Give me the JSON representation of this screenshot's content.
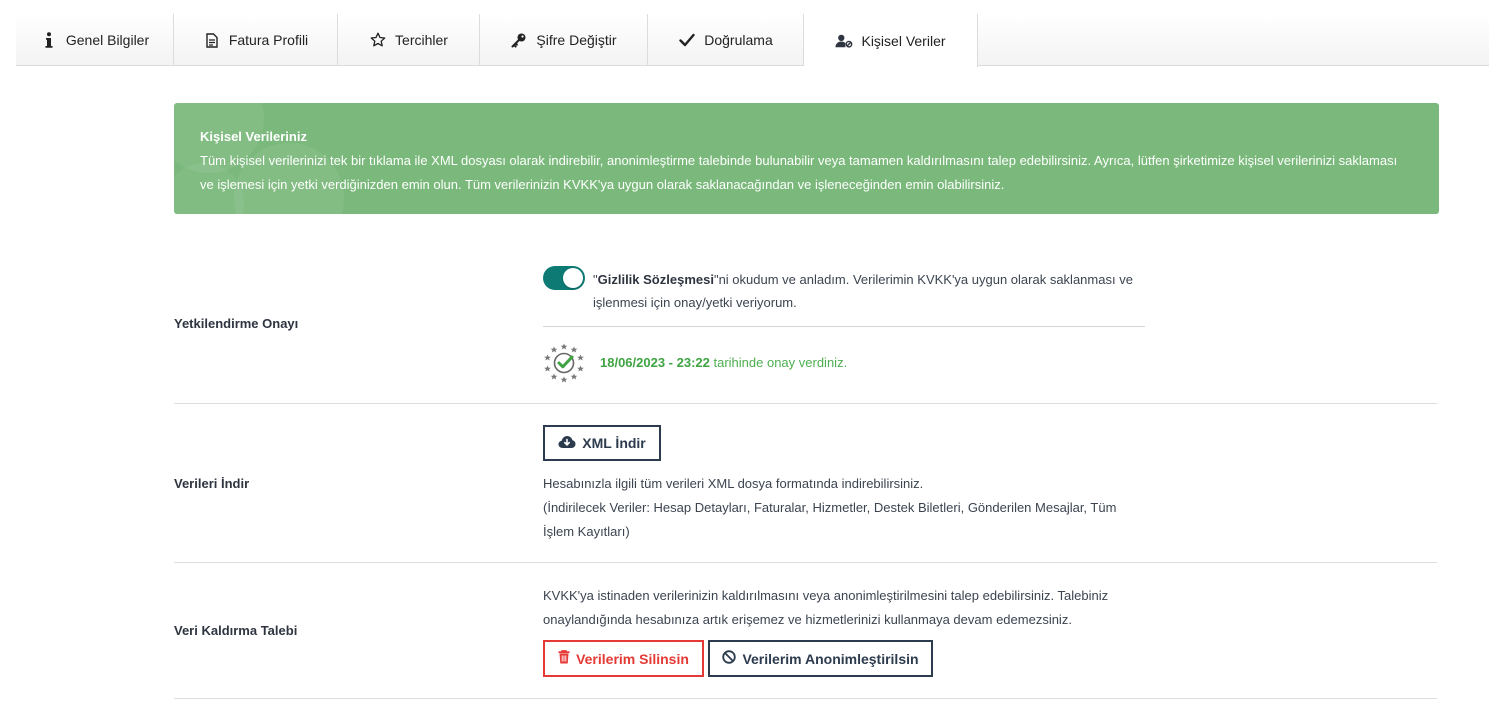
{
  "tabs": [
    {
      "label": "Genel Bilgiler",
      "icon": "info-icon"
    },
    {
      "label": "Fatura Profili",
      "icon": "document-icon"
    },
    {
      "label": "Tercihler",
      "icon": "star-icon"
    },
    {
      "label": "Şifre Değiştir",
      "icon": "key-icon"
    },
    {
      "label": "Doğrulama",
      "icon": "check-icon"
    },
    {
      "label": "Kişisel Veriler",
      "icon": "user-lock-icon",
      "active": true
    }
  ],
  "banner": {
    "title": "Kişisel Verileriniz",
    "text": "Tüm kişisel verilerinizi tek bir tıklama ile XML dosyası olarak indirebilir, anonimleştirme talebinde bulunabilir veya tamamen kaldırılmasını talep edebilirsiniz. Ayrıca, lütfen şirketimize kişisel verilerinizi saklaması ve işlemesi için yetki verdiğinizden emin olun. Tüm verilerinizin KVKK'ya uygun olarak saklanacağından ve işleneceğinden emin olabilirsiniz.",
    "color": "#7ab97b"
  },
  "authorization": {
    "label": "Yetkilendirme Onayı",
    "toggle_on": true,
    "consent_quote_open": "\"",
    "consent_link": "Gizlilik Sözleşmesi",
    "consent_text": "\"ni okudum ve anladım. Verilerimin KVKK'ya uygun olarak saklanması ve işlenmesi için onay/yetki veriyorum.",
    "approved_datetime": "18/06/2023 - 23:22",
    "approved_suffix": " tarihinde onay verdiniz."
  },
  "download": {
    "label": "Verileri İndir",
    "button": "XML İndir",
    "desc_line1": "Hesabınızla ilgili tüm verileri XML dosya formatında indirebilirsiniz.",
    "desc_line2": "(İndirilecek Veriler: Hesap Detayları, Faturalar, Hizmetler, Destek Biletleri, Gönderilen Mesajlar, Tüm İşlem Kayıtları)"
  },
  "removal": {
    "label": "Veri Kaldırma Talebi",
    "desc": "KVKK'ya istinaden verilerinizin kaldırılmasını veya anonimleştirilmesini talep edebilirsiniz. Talebiniz onaylandığında hesabınıza artık erişemez ve hizmetlerinizi kullanmaya devam edemezsiniz.",
    "delete_button": "Verilerim Silinsin",
    "anonymize_button": "Verilerim Anonimleştirilsin"
  },
  "colors": {
    "accent_teal": "#0e7a74",
    "success_green": "#4caf50",
    "danger_red": "#e53935",
    "navy": "#2d3b4e"
  }
}
